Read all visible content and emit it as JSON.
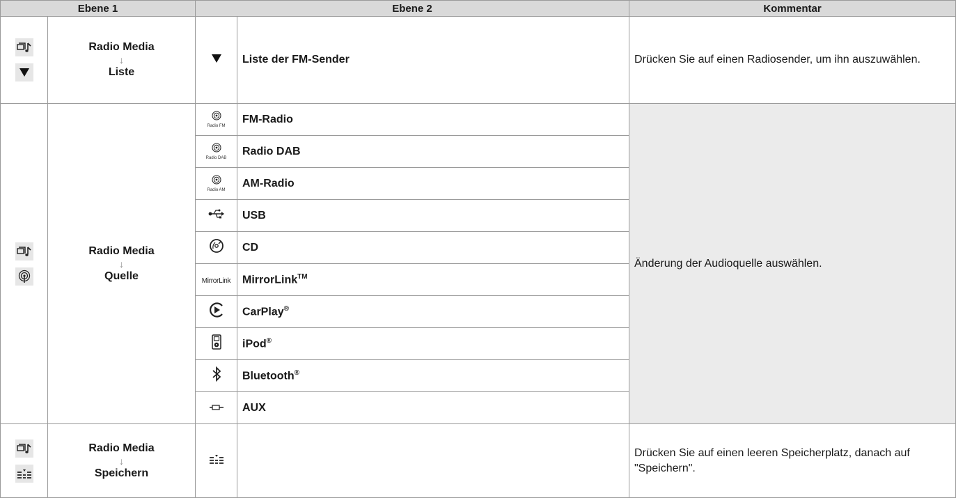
{
  "headers": {
    "level1": "Ebene 1",
    "level2": "Ebene 2",
    "comment": "Kommentar"
  },
  "rows": [
    {
      "level1_icons": [
        "media-icon",
        "triangle-down-icon"
      ],
      "path_top": "Radio Media",
      "path_bottom": "Liste",
      "arrow": "↓",
      "sub": [
        {
          "icon": "triangle-down-icon",
          "label": "Liste der FM-Sender"
        }
      ],
      "comment": "Drücken Sie auf einen Radiosender, um ihn auszuwählen."
    },
    {
      "level1_icons": [
        "media-icon",
        "radio-icon"
      ],
      "path_top": "Radio Media",
      "path_bottom": "Quelle",
      "arrow": "↓",
      "sub": [
        {
          "icon": "radio-fm-icon",
          "icon_caption": "Radio FM",
          "label": "FM-Radio"
        },
        {
          "icon": "radio-dab-icon",
          "icon_caption": "Radio DAB",
          "label": "Radio DAB"
        },
        {
          "icon": "radio-am-icon",
          "icon_caption": "Radio AM",
          "label": "AM-Radio"
        },
        {
          "icon": "usb-icon",
          "label": "USB"
        },
        {
          "icon": "cd-icon",
          "label": "CD"
        },
        {
          "icon": "mirrorlink-icon",
          "icon_caption": "MirrorLink",
          "label": "MirrorLink",
          "sup": "TM"
        },
        {
          "icon": "carplay-icon",
          "label": "CarPlay",
          "sup": "®"
        },
        {
          "icon": "ipod-icon",
          "label": "iPod",
          "sup": "®"
        },
        {
          "icon": "bluetooth-icon",
          "label": "Bluetooth",
          "sup": "®"
        },
        {
          "icon": "aux-icon",
          "label": "AUX"
        }
      ],
      "comment": "Änderung der Audioquelle auswählen."
    },
    {
      "level1_icons": [
        "media-icon",
        "presets-icon"
      ],
      "path_top": "Radio Media",
      "path_bottom": "Speichern",
      "arrow": "↓",
      "sub": [
        {
          "icon": "presets-icon",
          "label": ""
        }
      ],
      "comment": "Drücken Sie auf einen leeren Speicherplatz, danach auf \"Speichern\"."
    }
  ]
}
